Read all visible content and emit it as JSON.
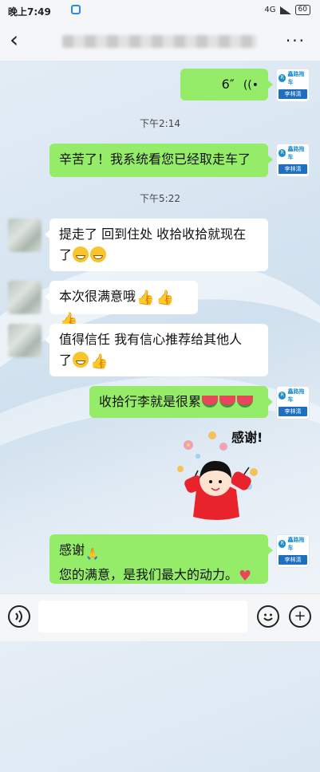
{
  "status_bar": {
    "time": "晚上7:49",
    "network": "4G",
    "battery": "60"
  },
  "nav": {
    "title": "",
    "more": "···"
  },
  "avatars": {
    "agent_logo": "鑫路拖车",
    "agent_name": "李林清"
  },
  "messages": {
    "m1": {
      "text": "6″"
    },
    "t1": "下午2:14",
    "m2": {
      "text": "辛苦了！我系统看您已经取走车了"
    },
    "t2": "下午5:22",
    "m3": {
      "line1": "提走了 回到住处 收拾收拾就现在",
      "line2": "了"
    },
    "m4": {
      "text": "本次很满意哦"
    },
    "m5": {
      "line1": "值得信任 我有信心推荐给其他人",
      "line2": "了"
    },
    "m6": {
      "text": "收拾行李就是很累"
    },
    "sticker": {
      "caption": "感谢!"
    },
    "m7": {
      "line1": "感谢",
      "line2": "您的满意，是我们最大的动力。"
    }
  },
  "icons": {
    "voice": "voice-wave-icon",
    "emoji": "emoji-face-icon",
    "add": "add-circle-icon"
  }
}
